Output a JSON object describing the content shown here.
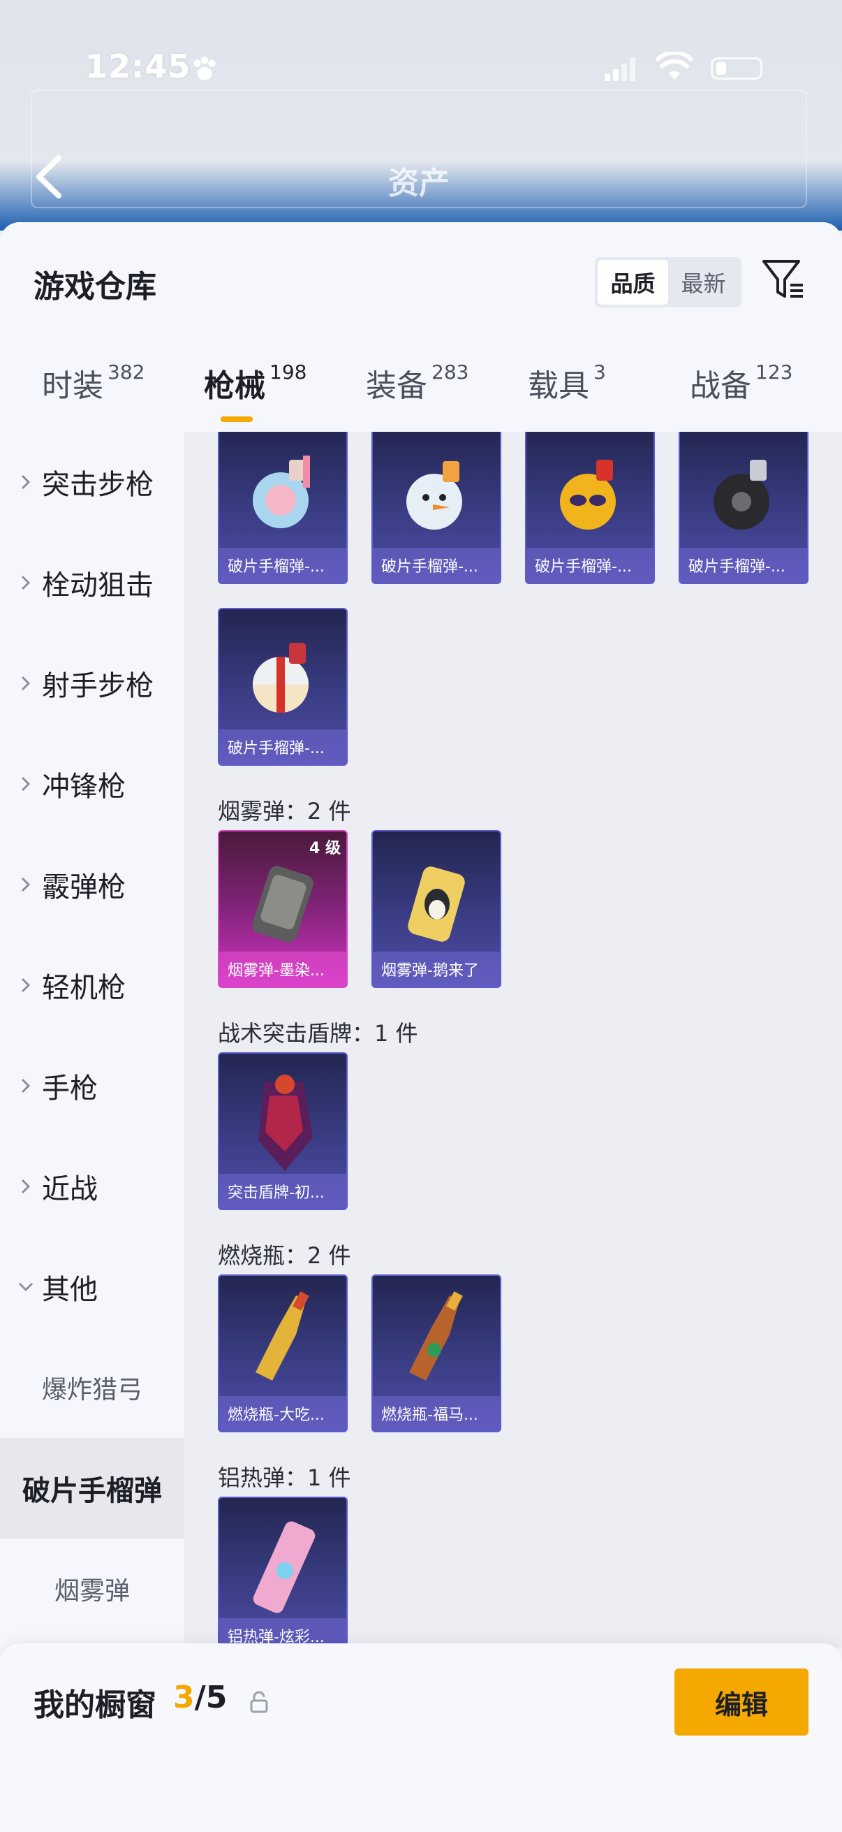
{
  "status_bar": {
    "time": "12:45"
  },
  "header": {
    "title": "资产"
  },
  "sheet": {
    "title": "游戏仓库",
    "sort": {
      "options": [
        "品质",
        "最新"
      ],
      "selected": "品质"
    }
  },
  "tabs": [
    {
      "label": "时装",
      "count": "382",
      "active": false
    },
    {
      "label": "枪械",
      "count": "198",
      "active": true
    },
    {
      "label": "装备",
      "count": "283",
      "active": false
    },
    {
      "label": "载具",
      "count": "3",
      "active": false
    },
    {
      "label": "战备",
      "count": "123",
      "active": false
    }
  ],
  "categories": [
    {
      "label": "突击步枪",
      "expanded": false
    },
    {
      "label": "栓动狙击",
      "expanded": false
    },
    {
      "label": "射手步枪",
      "expanded": false
    },
    {
      "label": "冲锋枪",
      "expanded": false
    },
    {
      "label": "霰弹枪",
      "expanded": false
    },
    {
      "label": "轻机枪",
      "expanded": false
    },
    {
      "label": "手枪",
      "expanded": false
    },
    {
      "label": "近战",
      "expanded": false
    },
    {
      "label": "其他",
      "expanded": true
    }
  ],
  "subcategories": [
    {
      "label": "爆炸猎弓",
      "selected": false
    },
    {
      "label": "破片手榴弹",
      "selected": true
    },
    {
      "label": "烟雾弹",
      "selected": false
    }
  ],
  "grenade_items": [
    "破片手榴弹-...",
    "破片手榴弹-...",
    "破片手榴弹-...",
    "破片手榴弹-...",
    "破片手榴弹-..."
  ],
  "sections": [
    {
      "title": "烟雾弹：2 件",
      "items": [
        {
          "caption": "烟雾弹-墨染...",
          "level": "4 级",
          "rarity": "pink"
        },
        {
          "caption": "烟雾弹-鹅来了",
          "rarity": "purple"
        }
      ]
    },
    {
      "title": "战术突击盾牌：1 件",
      "items": [
        {
          "caption": "突击盾牌-初...",
          "rarity": "purple"
        }
      ]
    },
    {
      "title": "燃烧瓶：2 件",
      "items": [
        {
          "caption": "燃烧瓶-大吃...",
          "rarity": "purple"
        },
        {
          "caption": "燃烧瓶-福马...",
          "rarity": "purple"
        }
      ]
    },
    {
      "title": "铝热弹：1 件",
      "items": [
        {
          "caption": "铝热弹-炫彩...",
          "rarity": "purple"
        }
      ]
    }
  ],
  "bottom_bar": {
    "label": "我的橱窗",
    "current": "3",
    "total": "/5",
    "edit_label": "编辑"
  },
  "colors": {
    "accent": "#f5a800",
    "card_purple": "#4f4ca7",
    "card_pink": "#d033c4"
  }
}
